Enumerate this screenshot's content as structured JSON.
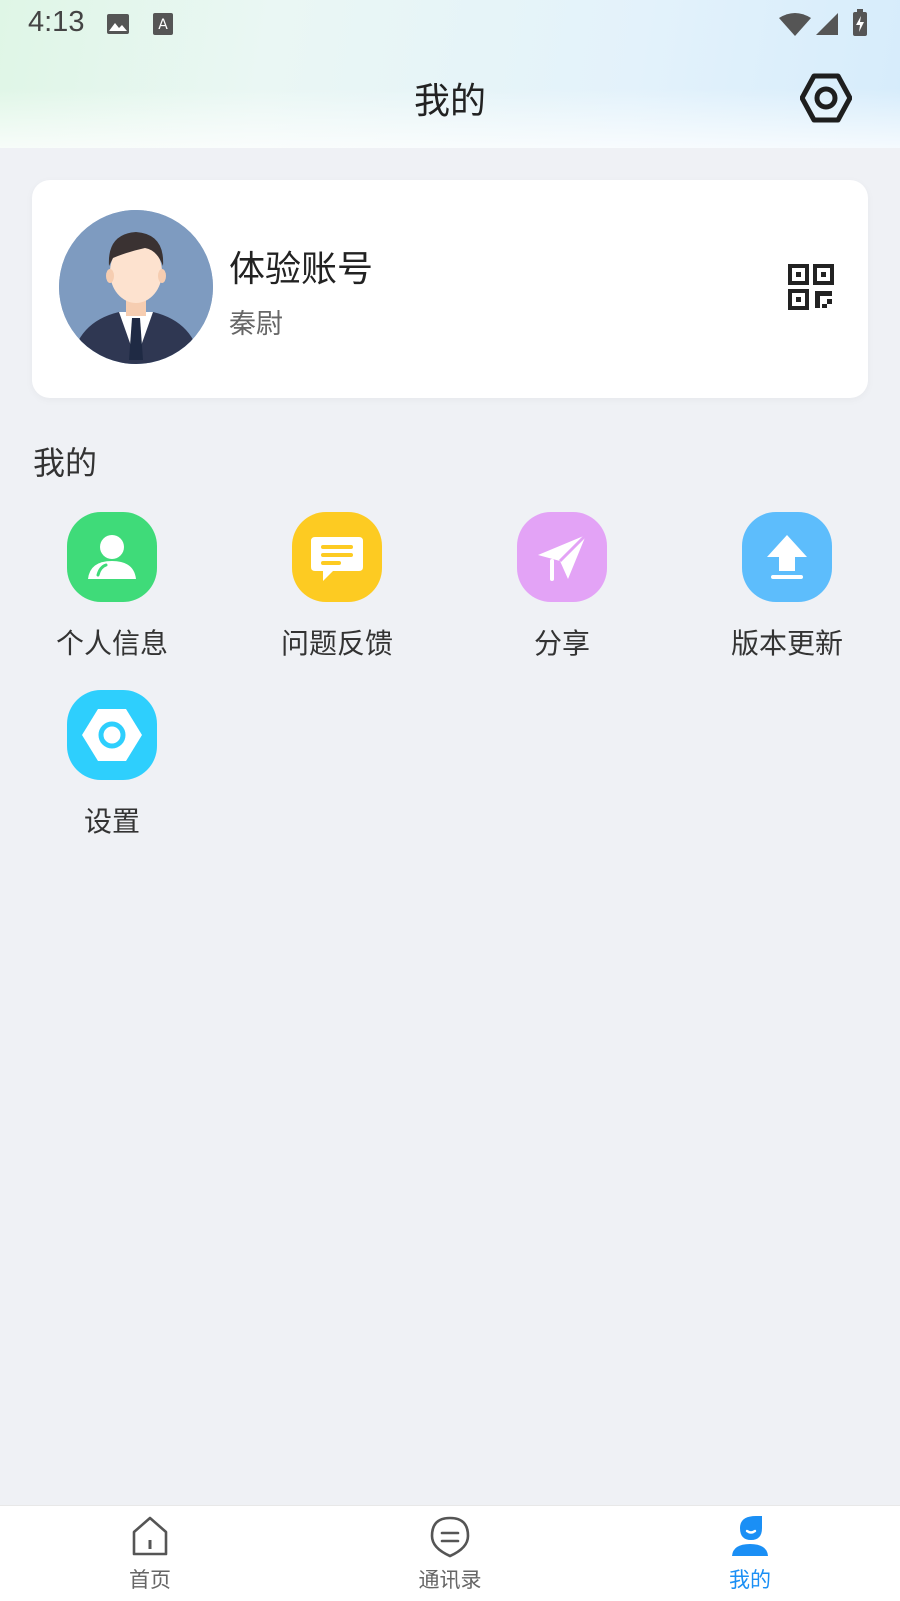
{
  "status_bar": {
    "time": "4:13",
    "icons": [
      "image-icon",
      "text-a-icon",
      "wifi-icon",
      "signal-icon",
      "battery-icon"
    ]
  },
  "header": {
    "title": "我的",
    "settings_icon": "hexagon-settings-icon"
  },
  "profile": {
    "name": "体验账号",
    "subtitle": "秦尉",
    "qr_icon": "qr-code-icon"
  },
  "section": {
    "title": "我的"
  },
  "grid": [
    {
      "label": "个人信息",
      "icon": "person-icon",
      "color": "#3fdb79"
    },
    {
      "label": "问题反馈",
      "icon": "message-icon",
      "color": "#fdcb22"
    },
    {
      "label": "分享",
      "icon": "paper-plane-icon",
      "color": "#e3a3f6"
    },
    {
      "label": "版本更新",
      "icon": "upload-icon",
      "color": "#5dbdfc"
    },
    {
      "label": "设置",
      "icon": "hexagon-settings-icon",
      "color": "#2ecffd"
    }
  ],
  "bottom_nav": [
    {
      "label": "首页",
      "icon": "home-icon",
      "active": false
    },
    {
      "label": "通讯录",
      "icon": "contacts-icon",
      "active": false
    },
    {
      "label": "我的",
      "icon": "profile-icon",
      "active": true
    }
  ],
  "colors": {
    "accent": "#1a8ff5",
    "background": "#eff1f5"
  }
}
